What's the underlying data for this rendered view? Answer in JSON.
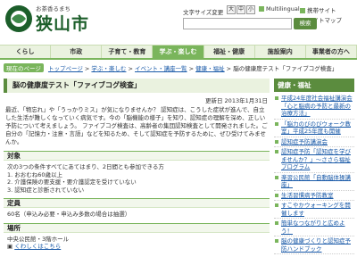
{
  "header": {
    "logo_kana": "お茶香るまち",
    "logo_name": "狭山市",
    "font_size_label": "文字サイズ変更",
    "font_size_buttons": [
      "大",
      "中",
      "小"
    ],
    "util_links": [
      "Multilingual",
      "携帯サイト",
      "サイトマップ"
    ],
    "search_button": "検索"
  },
  "nav": [
    {
      "label": "くらし",
      "active": false
    },
    {
      "label": "市政",
      "active": false
    },
    {
      "label": "子育て・教育",
      "active": false
    },
    {
      "label": "学ぶ・楽しむ",
      "active": true
    },
    {
      "label": "福祉・健康",
      "active": false
    },
    {
      "label": "施設案内",
      "active": false
    },
    {
      "label": "事業者の方へ",
      "active": false
    }
  ],
  "breadcrumb": {
    "lead": "現在のページ",
    "items": [
      "トップページ",
      "学ぶ・楽しむ",
      "イベント・講座一覧",
      "健康・福祉",
      "脳の健康度テスト「ファイブコグ検査」"
    ]
  },
  "page": {
    "title": "脳の健康度テスト「ファイブコグ検査」",
    "updated": "更新日 2013年1月31日",
    "intro": "最近、「物忘れ」や「うっかりミス」が気になりませんか？ 認知症は、こうした症状が進んで、自立した生活が難しくなっていく病気です。今の「脳機能の様子」を知り、認知症の理解を深め、正しい予防について考えましょう。 ファイブコグ検査は、高齢者の集団認知検査として開発されました。ご自分の「記憶力・注意・言語」などを知るため、そして認知症を予防するために、ぜひ受けてみませんか。",
    "sections": [
      {
        "heading": "対象",
        "lines": [
          "次の3つの条件すべてにあてはまり、2日間とも参加できる方",
          "1. おおむね60歳以上",
          "2. 介護保険の要支援・要介護認定を受けていない",
          "3. 認知症と診断されていない"
        ]
      },
      {
        "heading": "定員",
        "lines": [
          "60名（申込み必要・申込み多数の場合は抽選）"
        ]
      },
      {
        "heading": "場所",
        "lines": [
          "中央公民館・3階ホール"
        ],
        "link": "くわしくはこちら"
      }
    ]
  },
  "sidebar": {
    "heading": "健康・福祉",
    "items": [
      "平成24年度社会福祉講演会「心と脳病の予防と最新の治療方法」",
      "「脳力のびのびウォーク教室」平成25年度も開催",
      "認知症予防講演会",
      "認知症予防「認知症を学びませんか？」～ささら福祉プログラム",
      "楽習公民館「自動脳体操講座」",
      "生活習慣病予防教室",
      "すこやかウォーキングを開催します",
      "簡単なつながりと広めよう！",
      "脳の健康づくりと認知症予防ハンドブック"
    ]
  },
  "colors": {
    "brand_green": "#5b8c3e",
    "nav_bg": "#eaf2df",
    "link_blue": "#1a5aa8"
  }
}
